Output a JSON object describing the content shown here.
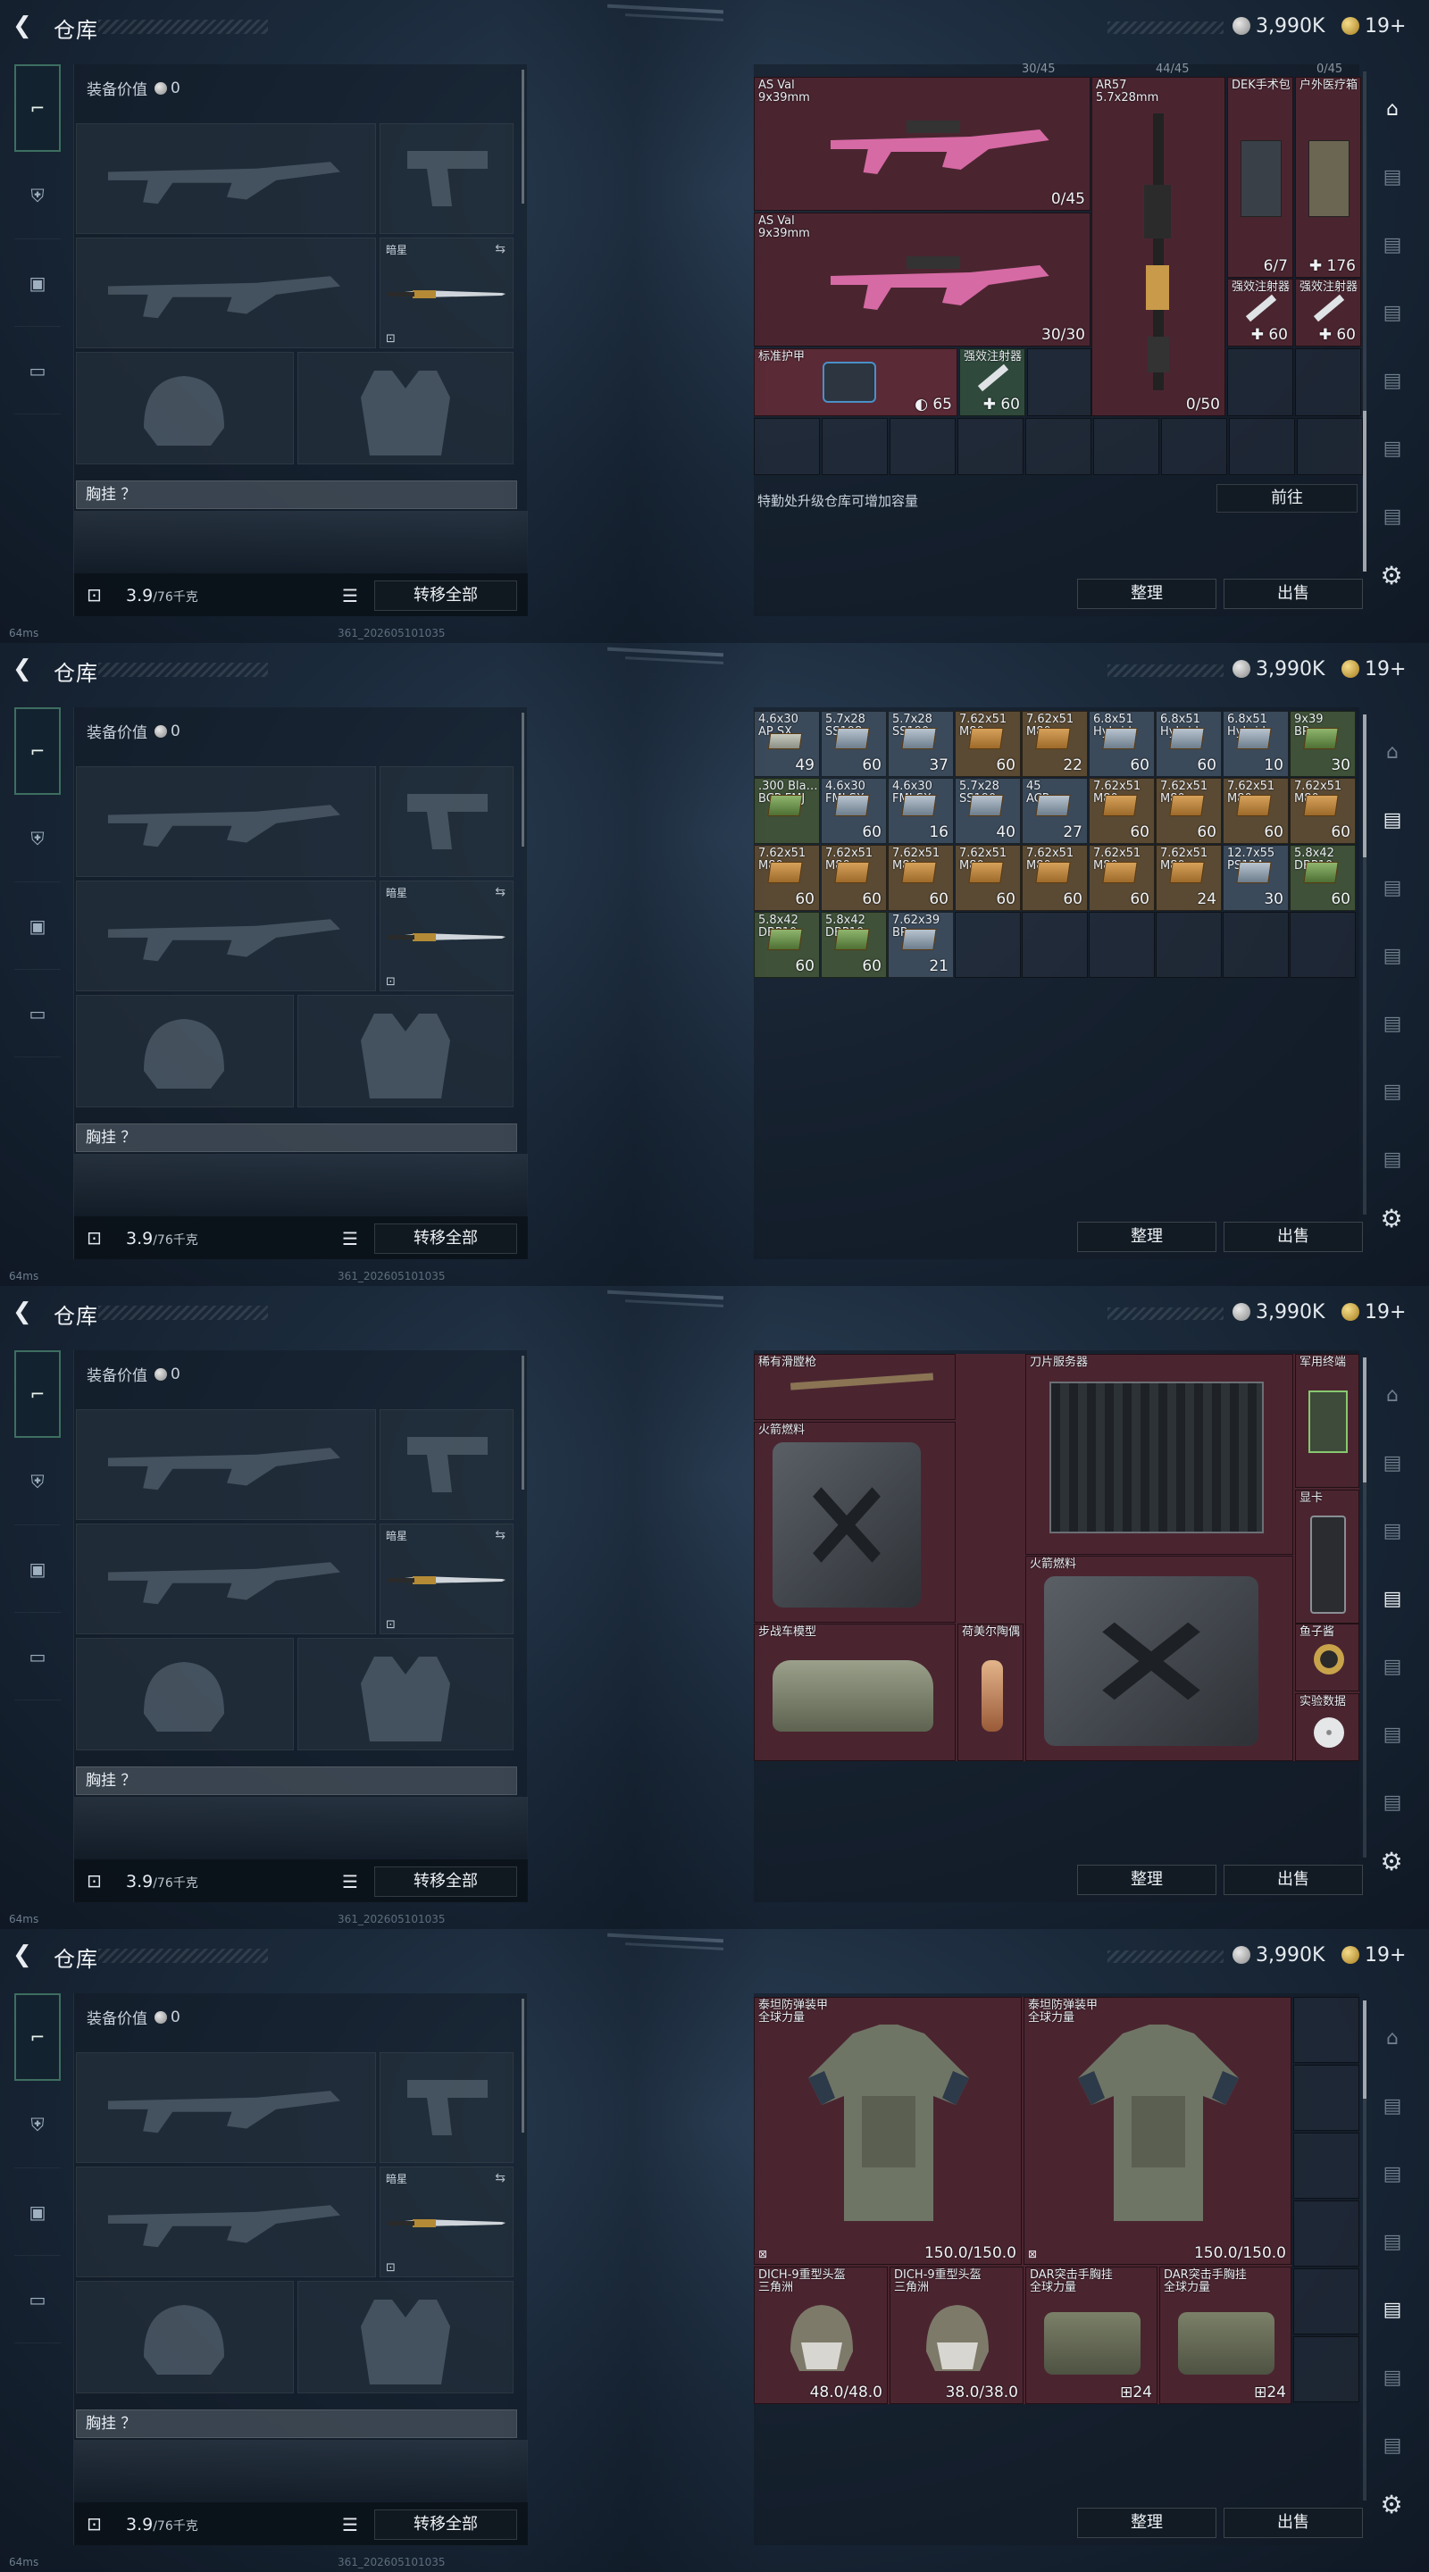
{
  "common": {
    "title": "仓库",
    "silver": "3,990K",
    "gold": "19+",
    "equip_value_label": "装备价值",
    "equip_value": "0",
    "knife_label": "暗星",
    "chest_label": "胸挂 ？",
    "weight_value": "3.9",
    "weight_max": "/76千克",
    "transfer_all": "转移全部",
    "sort": "整理",
    "sell": "出售",
    "status": "64ms",
    "build": "361_202605101035"
  },
  "screen1": {
    "header_numbers": [
      "30/45",
      "44/45",
      "0/45"
    ],
    "items": [
      {
        "name": "AS Val\n9x39mm",
        "count": "0/45"
      },
      {
        "name": "AS Val\n9x39mm",
        "count": "30/30"
      },
      {
        "name": "AR57\n5.7x28mm",
        "count": "0/50"
      },
      {
        "name": "DEK手术包",
        "count": "6/7"
      },
      {
        "name": "户外医疗箱",
        "count": "✚ 176"
      },
      {
        "name": "强效注射器",
        "count": "✚ 60"
      },
      {
        "name": "强效注射器",
        "count": "✚ 60"
      },
      {
        "name": "标准护甲",
        "count": "◐ 65"
      },
      {
        "name": "强效注射器",
        "count": "✚ 60"
      }
    ],
    "notice": "特勤处升级仓库可增加容量",
    "goto": "前往"
  },
  "screen2": {
    "ammo": [
      {
        "name": "4.6x30\nAP SX",
        "count": "49"
      },
      {
        "name": "5.7x28\nSS198",
        "count": "60"
      },
      {
        "name": "5.7x28\nSS190",
        "count": "37"
      },
      {
        "name": "7.62x51\nM80",
        "count": "60"
      },
      {
        "name": "7.62x51\nM80",
        "count": "22"
      },
      {
        "name": "6.8x51\nHybrid",
        "count": "60"
      },
      {
        "name": "6.8x51\nHybrid",
        "count": "60"
      },
      {
        "name": "6.8x51\nHybrid",
        "count": "10"
      },
      {
        "name": "9x39\nBP",
        "count": "30"
      },
      {
        "name": ".300 Bla…\nBCP FMJ",
        "count": ""
      },
      {
        "name": "4.6x30\nFMJ SX",
        "count": "60"
      },
      {
        "name": "4.6x30\nFMJ SX",
        "count": "16"
      },
      {
        "name": "5.7x28\nSS190",
        "count": "40"
      },
      {
        "name": "45\nACP",
        "count": "27"
      },
      {
        "name": "7.62x51\nM80",
        "count": "60"
      },
      {
        "name": "7.62x51\nM80",
        "count": "60"
      },
      {
        "name": "7.62x51\nM80",
        "count": "60"
      },
      {
        "name": "7.62x51\nM80",
        "count": "60"
      },
      {
        "name": "7.62x51\nM80",
        "count": "60"
      },
      {
        "name": "7.62x51\nM80",
        "count": "60"
      },
      {
        "name": "7.62x51\nM80",
        "count": "60"
      },
      {
        "name": "7.62x51\nM80",
        "count": "60"
      },
      {
        "name": "7.62x51\nM80",
        "count": "60"
      },
      {
        "name": "7.62x51\nM80",
        "count": "60"
      },
      {
        "name": "7.62x51\nM80",
        "count": "24"
      },
      {
        "name": "12.7x55\nPS12A",
        "count": "30"
      },
      {
        "name": "5.8x42\nDBP10",
        "count": "60"
      },
      {
        "name": "5.8x42\nDBP10",
        "count": "60"
      },
      {
        "name": "5.8x42\nDBP10",
        "count": "60"
      },
      {
        "name": "7.62x39\nBP",
        "count": "21"
      }
    ]
  },
  "screen3": {
    "items": [
      {
        "name": "稀有滑膛枪"
      },
      {
        "name": "刀片服务器"
      },
      {
        "name": "军用终端"
      },
      {
        "name": "火箭燃料"
      },
      {
        "name": "显卡"
      },
      {
        "name": "火箭燃料"
      },
      {
        "name": "鱼子酱"
      },
      {
        "name": "步战车模型"
      },
      {
        "name": "荷美尔陶偶"
      },
      {
        "name": "实验数据"
      }
    ]
  },
  "screen4": {
    "items": [
      {
        "name": "泰坦防弹装甲\n全球力量",
        "count": "150.0/150.0"
      },
      {
        "name": "泰坦防弹装甲\n全球力量",
        "count": "150.0/150.0"
      },
      {
        "name": "DICH-9重型头盔\n三角洲",
        "count": "48.0/48.0"
      },
      {
        "name": "DICH-9重型头盔\n三角洲",
        "count": "38.0/38.0"
      },
      {
        "name": "DAR突击手胸挂\n全球力量",
        "count": "⊞24"
      },
      {
        "name": "DAR突击手胸挂\n全球力量",
        "count": "⊞24"
      }
    ]
  }
}
